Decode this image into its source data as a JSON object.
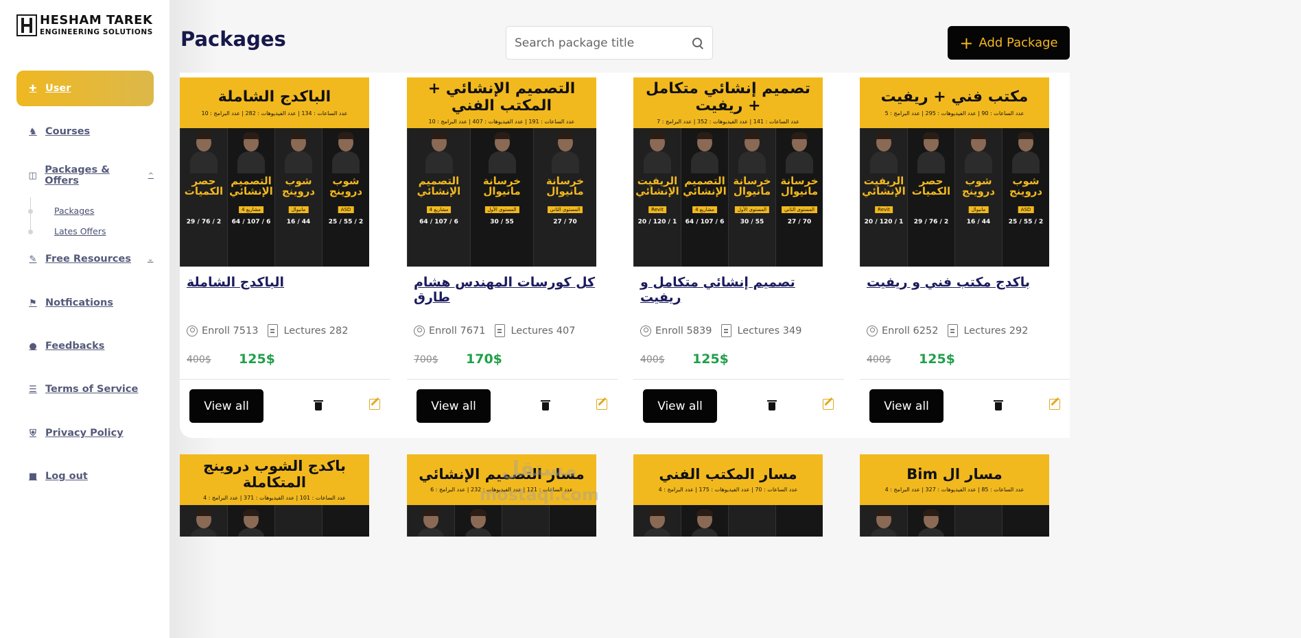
{
  "brand": {
    "line1": "HESHAM TAREK",
    "line2": "ENGINEERING SOLUTIONS"
  },
  "sidebar": {
    "items": [
      {
        "label": "User",
        "icon": "user-plus-icon",
        "active": true
      },
      {
        "label": "Courses",
        "icon": "teacher-icon"
      },
      {
        "label": "Packages & Offers",
        "icon": "bag-icon",
        "caret": "^"
      },
      {
        "label": "Free Resources",
        "icon": "edit-square-icon",
        "caret": "⌄"
      },
      {
        "label": "Notfications",
        "icon": "bell-icon"
      },
      {
        "label": "Feedbacks",
        "icon": "chat-icon"
      },
      {
        "label": "Terms of Service",
        "icon": "list-icon"
      },
      {
        "label": "Privacy Policy",
        "icon": "shield-icon"
      },
      {
        "label": "Log out",
        "icon": "trash-icon"
      }
    ],
    "sub_items": [
      "Packages",
      "Lates Offers"
    ]
  },
  "header": {
    "title": "Packages",
    "search_placeholder": "Search package title",
    "add_button": "Add Package",
    "add_icon": "+"
  },
  "colors": {
    "accent": "#f2b91e",
    "price": "#20a049",
    "dark": "#050505"
  },
  "cards": [
    {
      "thumb_title": "الباكدج الشاملة",
      "thumb_meta": "عدد الساعات : 134 | عدد الفيديوهات : 282 | عدد البرامج : 10",
      "columns": [
        {
          "title": "حصر الكميات",
          "tag": "",
          "stats": "29 / 76 / 2"
        },
        {
          "title": "التصميم الإنشائي",
          "tag": "4 مشاريع",
          "stats": "64 / 107 / 6"
        },
        {
          "title": "شوب دروينج",
          "tag": "مانيوال",
          "stats": "16 / 44"
        },
        {
          "title": "شوب دروينج",
          "tag": "ASD",
          "stats": "25 / 55 / 2"
        }
      ],
      "name": "الباكدج الشاملة",
      "enroll": "Enroll 7513",
      "lectures": "Lectures 282",
      "old_price": "400$",
      "new_price": "125$"
    },
    {
      "thumb_title": "التصميم الإنشائي + المكتب الفني",
      "thumb_meta": "عدد الساعات : 191 | عدد الفيديوهات : 407 | عدد البرامج : 10",
      "columns": [
        {
          "title": "التصميم الإنشائي",
          "tag": "4 مشاريع",
          "stats": "64 / 107 / 6"
        },
        {
          "title": "خرسانة مانيوال",
          "tag": "المستوى الأول",
          "stats": "30 / 55"
        },
        {
          "title": "خرسانة مانيوال",
          "tag": "المستوى الثاني",
          "stats": "27 / 70"
        }
      ],
      "name": "كل كورسات المهندس هشام طارق",
      "enroll": "Enroll 7671",
      "lectures": "Lectures 407",
      "old_price": "700$",
      "new_price": "170$"
    },
    {
      "thumb_title": "تصميم إنشائي متكامل + ريفيت",
      "thumb_meta": "عدد الساعات : 141 | عدد الفيديوهات : 352 | عدد البرامج : 7",
      "columns": [
        {
          "title": "الريفيت الإنشائي",
          "tag": "Revit",
          "stats": "20 / 120 / 1"
        },
        {
          "title": "التصميم الإنشائي",
          "tag": "4 مشاريع",
          "stats": "64 / 107 / 6"
        },
        {
          "title": "خرسانة مانيوال",
          "tag": "المستوى الأول",
          "stats": "30 / 55"
        },
        {
          "title": "خرسانة مانيوال",
          "tag": "المستوى الثاني",
          "stats": "27 / 70"
        }
      ],
      "name": "تصميم إنشائي متكامل و ريفيت",
      "enroll": "Enroll 5839",
      "lectures": "Lectures 349",
      "old_price": "400$",
      "new_price": "125$"
    },
    {
      "thumb_title": "مكتب فني + ريفيت",
      "thumb_meta": "عدد الساعات : 90 | عدد الفيديوهات : 295 | عدد البرامج : 5",
      "columns": [
        {
          "title": "الريفيت الإنشائي",
          "tag": "Revit",
          "stats": "20 / 120 / 1"
        },
        {
          "title": "حصر الكميات",
          "tag": "",
          "stats": "29 / 76 / 2"
        },
        {
          "title": "شوب دروينج",
          "tag": "مانيوال",
          "stats": "16 / 44"
        },
        {
          "title": "شوب دروينج",
          "tag": "ASD",
          "stats": "25 / 55 / 2"
        }
      ],
      "name": "باكدج مكتب فني و ريفيت",
      "enroll": "Enroll 6252",
      "lectures": "Lectures 292",
      "old_price": "400$",
      "new_price": "125$"
    }
  ],
  "card_actions": {
    "view": "View all",
    "delete_icon": "trash-icon",
    "edit_icon": "edit-icon"
  },
  "bottom_row": [
    {
      "title": "باكدج الشوب دروينج المتكاملة",
      "meta": "عدد الساعات : 101 | عدد الفيديوهات : 371 | عدد البرامج : 4"
    },
    {
      "title": "مسار التصميم الإنشائي",
      "meta": "عدد الساعات : 121 | عدد الفيديوهات : 232 | عدد البرامج : 6"
    },
    {
      "title": "مسار المكتب الفني",
      "meta": "عدد الساعات : 70 | عدد الفيديوهات : 175 | عدد البرامج : 4"
    },
    {
      "title": "مسار ال Bim",
      "meta": "عدد الساعات : 85 | عدد الفيديوهات : 327 | عدد البرامج : 4"
    }
  ],
  "watermark": {
    "line1": "مستقل",
    "line2": "mostaql.com"
  }
}
